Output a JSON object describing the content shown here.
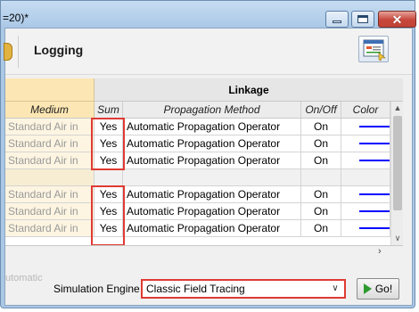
{
  "window": {
    "title_fragment": "=20)*",
    "minimize_icon": "minimize-icon",
    "maximize_icon": "maximize-icon",
    "close_icon": "close-icon",
    "close_glyph": "✕"
  },
  "toolbar": {
    "logging_label": "Logging",
    "report_icon": "report-icon"
  },
  "grid": {
    "group_header": "Linkage",
    "columns": {
      "medium": "Medium",
      "sum": "Sum",
      "method": "Propagation Method",
      "onoff": "On/Off",
      "color": "Color"
    },
    "rows": [
      {
        "medium": "Standard Air in",
        "sum": "Yes",
        "method": "Automatic Propagation Operator",
        "onoff": "On",
        "color": "#0000ff"
      },
      {
        "medium": "Standard Air in",
        "sum": "Yes",
        "method": "Automatic Propagation Operator",
        "onoff": "On",
        "color": "#0000ff"
      },
      {
        "medium": "Standard Air in",
        "sum": "Yes",
        "method": "Automatic Propagation Operator",
        "onoff": "On",
        "color": "#0000ff"
      },
      {
        "medium": "",
        "sum": "",
        "method": "",
        "onoff": "",
        "color": ""
      },
      {
        "medium": "Standard Air in",
        "sum": "Yes",
        "method": "Automatic Propagation Operator",
        "onoff": "On",
        "color": "#0000ff"
      },
      {
        "medium": "Standard Air in",
        "sum": "Yes",
        "method": "Automatic Propagation Operator",
        "onoff": "On",
        "color": "#0000ff"
      },
      {
        "medium": "Standard Air in",
        "sum": "Yes",
        "method": "Automatic Propagation Operator",
        "onoff": "On",
        "color": "#0000ff"
      }
    ],
    "scroll_up": "▲",
    "scroll_down": "∨",
    "scroll_right": "›"
  },
  "footer": {
    "ghost_text": "utomatic",
    "simulation_engine_label": "Simulation Engine",
    "engine_value": "Classic Field Tracing",
    "engine_arrow": "∨",
    "go_label": "Go!"
  },
  "colors": {
    "highlight": "#e03a33",
    "line": "#0000ff",
    "medium_bg": "#fce6b3"
  }
}
